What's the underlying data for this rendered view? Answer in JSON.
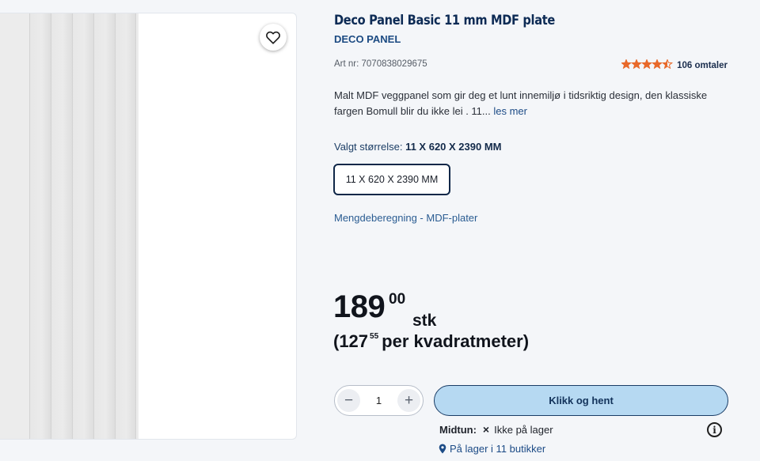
{
  "product": {
    "title": "Deco Panel Basic 11 mm MDF plate",
    "brand": "DECO PANEL",
    "art_nr": "Art nr: 7070838029675",
    "rating_value": 4.5,
    "reviews_label": "106 omtaler",
    "description": "Malt MDF veggpanel som gir deg et lunt innemiljø i tidsriktig design, den klassiske fargen Bomull blir du ikke lei . 11...",
    "read_more": "les mer"
  },
  "size": {
    "label": "Valgt størrelse:",
    "selected": "11 X 620 X 2390 MM",
    "option": "11 X 620 X 2390 MM"
  },
  "calc_link": "Mengdeberegning - MDF-plater",
  "price": {
    "main": "189",
    "decimals": "00",
    "unit": "stk",
    "sqm_open": "(127",
    "sqm_decimals": "55",
    "sqm_text": "per kvadratmeter)"
  },
  "cart": {
    "minus": "−",
    "quantity": "1",
    "plus": "+",
    "cta_label": "Klikk og hent"
  },
  "stock": {
    "store": "Midtun:",
    "status_icon": "×",
    "status": "Ikke på lager",
    "info_glyph": "i",
    "availability": "På lager i 11 butikker"
  },
  "icons": {
    "favorite": "heart-outline-icon",
    "stars": "star-icon",
    "info": "info-circle-icon",
    "location": "map-pin-icon"
  },
  "colors": {
    "brand_navy": "#0d2b55",
    "star_orange": "#e8692a",
    "cta_fill": "#b6d9f2",
    "link_blue": "#1c4b86"
  }
}
